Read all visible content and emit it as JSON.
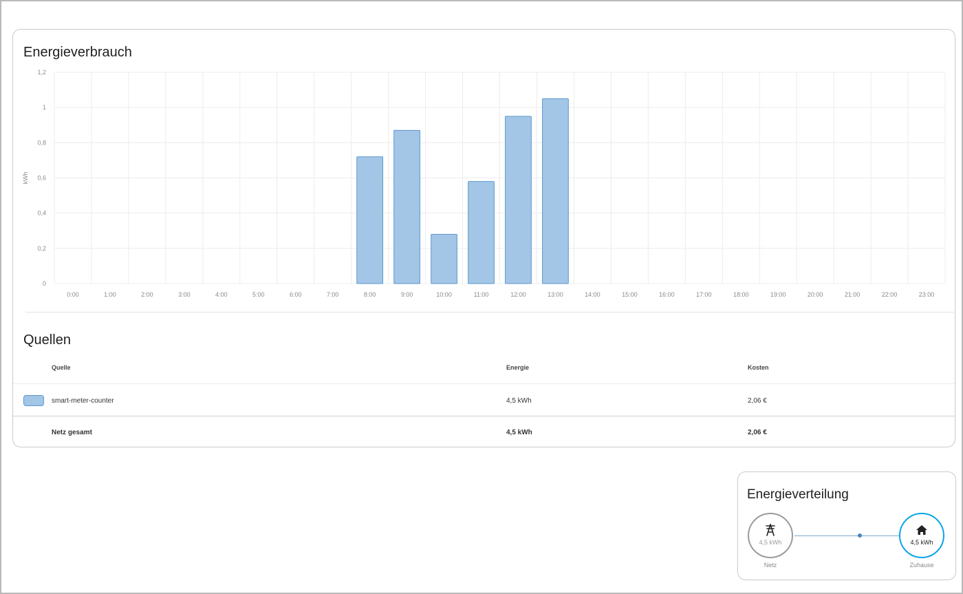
{
  "energy_chart": {
    "title": "Energieverbrauch"
  },
  "chart_data": {
    "type": "bar",
    "title": "Energieverbrauch",
    "xlabel": "",
    "ylabel": "kWh",
    "ylim": [
      0,
      1.2
    ],
    "yticks": [
      "0",
      "0,2",
      "0,4",
      "0,6",
      "0,8",
      "1",
      "1,2"
    ],
    "yticks_values": [
      0,
      0.2,
      0.4,
      0.6,
      0.8,
      1.0,
      1.2
    ],
    "categories": [
      "0:00",
      "1:00",
      "2:00",
      "3:00",
      "4:00",
      "5:00",
      "6:00",
      "7:00",
      "8:00",
      "9:00",
      "10:00",
      "11:00",
      "12:00",
      "13:00",
      "14:00",
      "15:00",
      "16:00",
      "17:00",
      "18:00",
      "19:00",
      "20:00",
      "21:00",
      "22:00",
      "23:00"
    ],
    "series": [
      {
        "name": "smart-meter-counter",
        "color": "#a3c6e6",
        "values": [
          0,
          0,
          0,
          0,
          0,
          0,
          0,
          0,
          0.72,
          0.87,
          0.28,
          0.58,
          0.95,
          1.05,
          0,
          0,
          0,
          0,
          0,
          0,
          0,
          0,
          0,
          0
        ]
      }
    ],
    "grid": true
  },
  "sources": {
    "title": "Quellen",
    "headers": {
      "source": "Quelle",
      "energy": "Energie",
      "cost": "Kosten"
    },
    "rows": [
      {
        "name": "smart-meter-counter",
        "energy": "4,5 kWh",
        "cost": "2,06 €",
        "color": "#a3c6e6"
      }
    ],
    "total": {
      "name": "Netz gesamt",
      "energy": "4,5 kWh",
      "cost": "2,06 €"
    }
  },
  "distribution": {
    "title": "Energieverteilung",
    "grid": {
      "value": "4,5 kWh",
      "label": "Netz",
      "icon": "transmission-tower-icon"
    },
    "home": {
      "value": "4,5 kWh",
      "label": "Zuhause",
      "icon": "home-icon"
    },
    "colors": {
      "grid_border": "#9a9a9a",
      "home_border": "#0ba4e8",
      "flow": "#4a86b8"
    }
  }
}
